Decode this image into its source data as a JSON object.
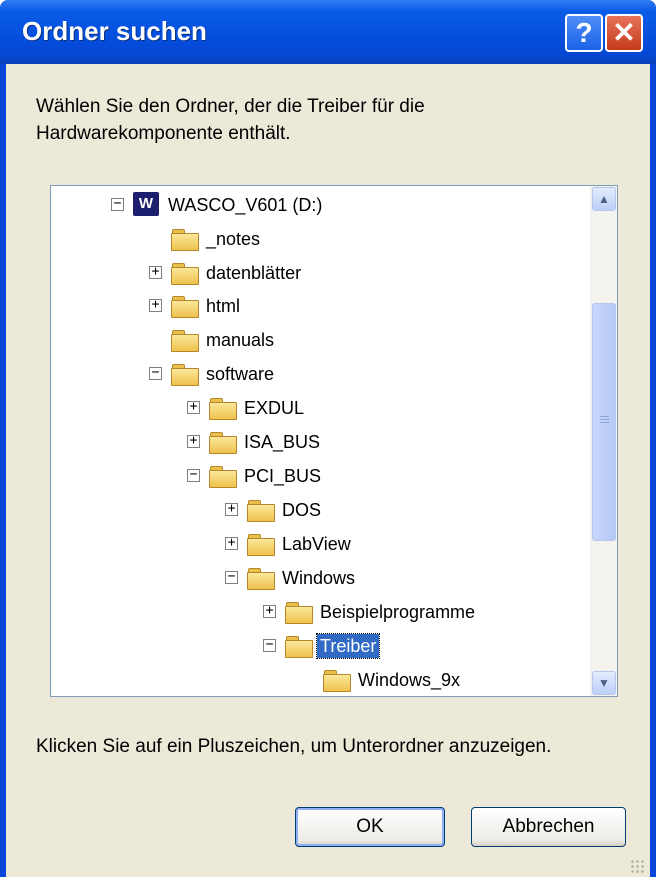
{
  "window": {
    "title": "Ordner suchen"
  },
  "titlebar": {
    "help_glyph": "?",
    "close_glyph": "✕"
  },
  "prompt": "Wählen Sie den Ordner, der die Treiber für die Hardwarekomponente enthält.",
  "tree": {
    "drive_glyph": "W",
    "items": [
      {
        "label": "WASCO_V601 (D:)",
        "expander": "−",
        "icon": "drive-icon"
      },
      {
        "label": "_notes",
        "expander": "",
        "icon": "folder-icon"
      },
      {
        "label": "datenblätter",
        "expander": "+",
        "icon": "folder-icon"
      },
      {
        "label": "html",
        "expander": "+",
        "icon": "folder-icon"
      },
      {
        "label": "manuals",
        "expander": "",
        "icon": "folder-icon"
      },
      {
        "label": "software",
        "expander": "−",
        "icon": "folder-icon"
      },
      {
        "label": "EXDUL",
        "expander": "+",
        "icon": "folder-icon"
      },
      {
        "label": "ISA_BUS",
        "expander": "+",
        "icon": "folder-icon"
      },
      {
        "label": "PCI_BUS",
        "expander": "−",
        "icon": "folder-icon"
      },
      {
        "label": "DOS",
        "expander": "+",
        "icon": "folder-icon"
      },
      {
        "label": "LabView",
        "expander": "+",
        "icon": "folder-icon"
      },
      {
        "label": "Windows",
        "expander": "−",
        "icon": "folder-icon"
      },
      {
        "label": "Beispielprogramme",
        "expander": "+",
        "icon": "folder-icon"
      },
      {
        "label": "Treiber",
        "expander": "−",
        "icon": "folder-open-icon",
        "selected": true
      },
      {
        "label": "Windows_9x",
        "expander": "",
        "icon": "folder-icon"
      }
    ]
  },
  "scrollbar": {
    "up_glyph": "▲",
    "down_glyph": "▼"
  },
  "hint": "Klicken Sie auf ein Pluszeichen, um Unterordner anzuzeigen.",
  "buttons": {
    "ok": "OK",
    "cancel": "Abbrechen"
  }
}
